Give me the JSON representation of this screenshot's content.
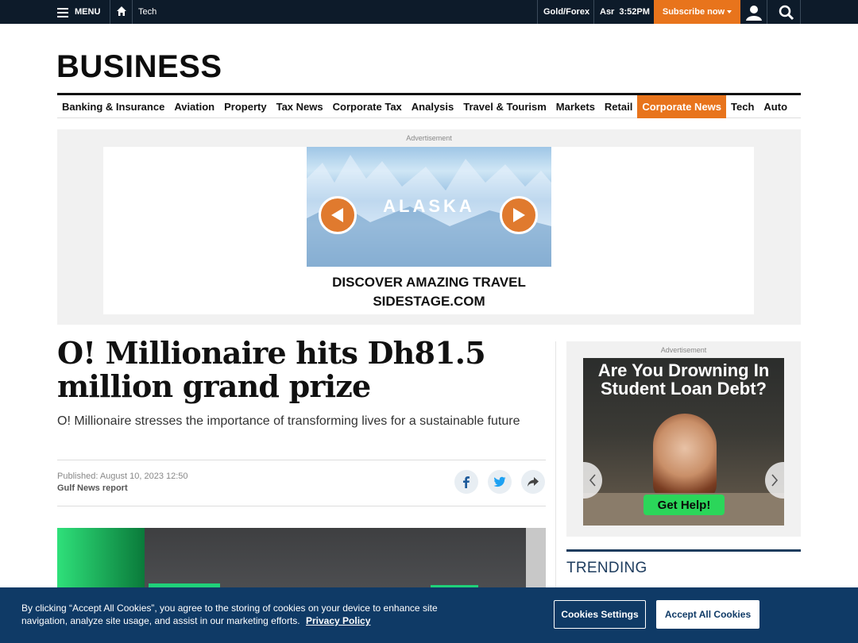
{
  "topbar": {
    "menu_label": "MENU",
    "breadcrumb": "Tech",
    "gold_forex": "Gold/Forex",
    "prayer_name": "Asr",
    "prayer_time": "3:52PM",
    "subscribe_label": "Subscribe now"
  },
  "masthead": "BUSINESS",
  "nav": {
    "items": [
      "Banking & Insurance",
      "Aviation",
      "Property",
      "Tax News",
      "Corporate Tax",
      "Analysis",
      "Travel & Tourism",
      "Markets",
      "Retail",
      "Corporate News",
      "Tech",
      "Auto"
    ],
    "active_index": 9
  },
  "top_ad": {
    "label": "Advertisement",
    "image_word": "ALASKA",
    "line1": "DISCOVER AMAZING TRAVEL",
    "line2": "SIDESTAGE.COM"
  },
  "article": {
    "headline": "O! Millionaire hits Dh81.5 million grand prize",
    "dek": "O! Millionaire stresses the importance of transforming lives for a sustainable future",
    "published_label": "Published:",
    "published_date": "August 10, 2023 12:50",
    "author": "Gulf News report"
  },
  "side_ad": {
    "label": "Advertisement",
    "headline": "Are You Drowning In Student Loan Debt?",
    "cta": "Get Help!"
  },
  "trending_title": "TRENDING",
  "cookie": {
    "text": "By clicking “Accept All Cookies”, you agree to the storing of cookies on your device to enhance site navigation, analyze site usage, and assist in our marketing efforts.",
    "policy_link": "Privacy Policy",
    "settings_label": "Cookies Settings",
    "accept_label": "Accept All Cookies"
  },
  "colors": {
    "topbar_bg": "#0d1b2a",
    "accent_orange": "#e8741c",
    "cookie_bg": "#0f3a66",
    "trending_blue": "#1d3c5e"
  }
}
